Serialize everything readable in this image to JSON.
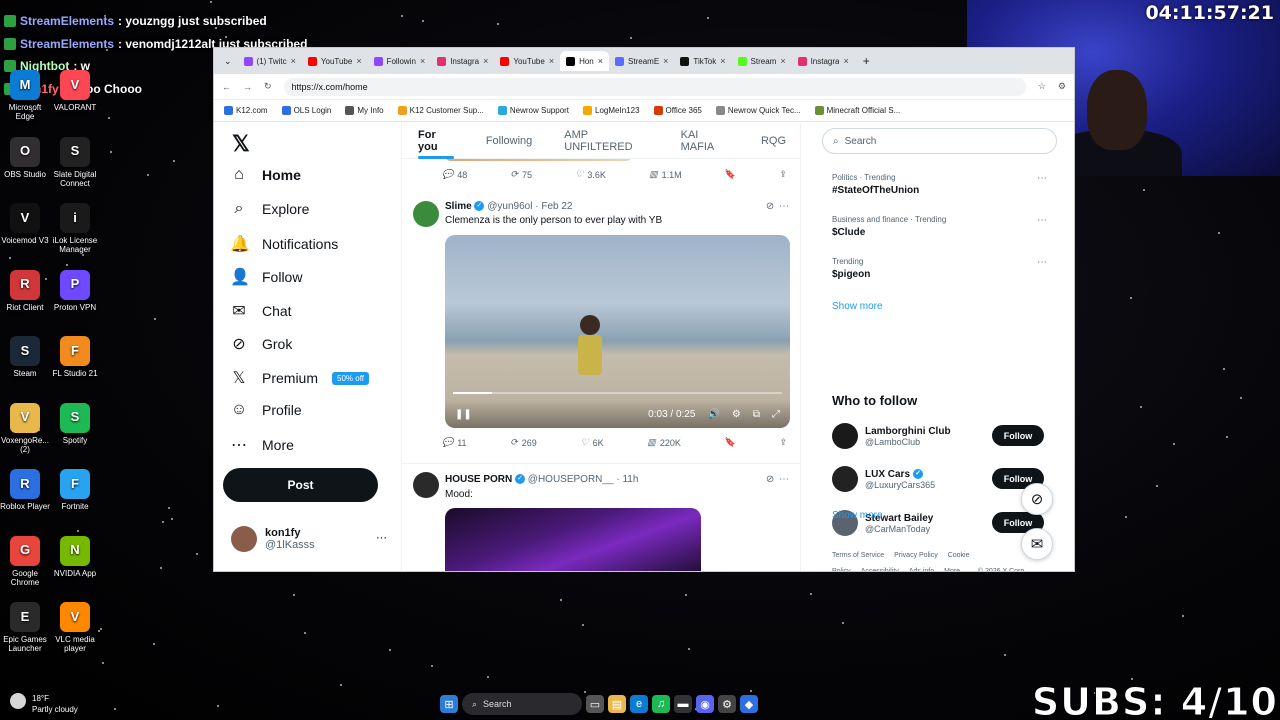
{
  "overlay": {
    "alerts": [
      {
        "who": "StreamElements",
        "text": ": youzngg just subscribed"
      },
      {
        "who": "StreamElements",
        "text": ": venomdj1212alt just subscribed"
      },
      {
        "who": "Nightbot",
        "text": ": w"
      },
      {
        "who": "kon1fy",
        "text": ": Choo Chooo"
      }
    ],
    "clock": "04:11:57:21",
    "subs": "SUBS: 4/10"
  },
  "desktop": {
    "icons": [
      {
        "label": "Microsoft Edge",
        "icon": "edge-icon",
        "color": "#0c7bd3"
      },
      {
        "label": "VALORANT",
        "icon": "valorant-icon",
        "color": "#ff4655"
      },
      {
        "label": "OBS Studio",
        "icon": "obs-icon",
        "color": "#302e31"
      },
      {
        "label": "Slate Digital Connect",
        "icon": "slate-icon",
        "color": "#222222"
      },
      {
        "label": "Voicemod V3",
        "icon": "voicemod-icon",
        "color": "#111111"
      },
      {
        "label": "iLok License Manager",
        "icon": "ilok-icon",
        "color": "#1a1a1a"
      },
      {
        "label": "Riot Client",
        "icon": "riot-icon",
        "color": "#d13639"
      },
      {
        "label": "Proton VPN",
        "icon": "proton-icon",
        "color": "#6d4aff"
      },
      {
        "label": "Steam",
        "icon": "steam-icon",
        "color": "#1b2838"
      },
      {
        "label": "FL Studio 21",
        "icon": "flstudio-icon",
        "color": "#f28b1e"
      },
      {
        "label": "VoxengoRe... (2)",
        "icon": "folder-icon",
        "color": "#e9b84a"
      },
      {
        "label": "Spotify",
        "icon": "spotify-icon",
        "color": "#1db954"
      },
      {
        "label": "Roblox Player",
        "icon": "roblox-icon",
        "color": "#2b6fe0"
      },
      {
        "label": "Fortnite",
        "icon": "fortnite-icon",
        "color": "#29a3f0"
      },
      {
        "label": "Google Chrome",
        "icon": "chrome-icon",
        "color": "#e8453c"
      },
      {
        "label": "NVIDIA App",
        "icon": "nvidia-icon",
        "color": "#76b900"
      },
      {
        "label": "Epic Games Launcher",
        "icon": "epic-icon",
        "color": "#2a2a2a"
      },
      {
        "label": "VLC media player",
        "icon": "vlc-icon",
        "color": "#ff8800"
      }
    ]
  },
  "browser": {
    "tabs": [
      {
        "label": "(1) Twitc",
        "color": "#9146ff"
      },
      {
        "label": "YouTube",
        "color": "#ff0000"
      },
      {
        "label": "Followin",
        "color": "#9146ff"
      },
      {
        "label": "Instagra",
        "color": "#e1306c"
      },
      {
        "label": "YouTube",
        "color": "#ff0000"
      },
      {
        "label": "Hon",
        "color": "#000000"
      },
      {
        "label": "StreamE",
        "color": "#5b6bff"
      },
      {
        "label": "TikTok",
        "color": "#111111"
      },
      {
        "label": "Stream",
        "color": "#53fc18"
      },
      {
        "label": "Instagra",
        "color": "#e1306c"
      }
    ],
    "url": "https://x.com/home",
    "bookmarks": [
      "K12.com",
      "OLS Login",
      "My Info",
      "K12 Customer Sup...",
      "Newrow Support",
      "LogMeIn123",
      "Office 365",
      "Newrow Quick Tec...",
      "Minecraft Official S..."
    ]
  },
  "nav": {
    "items": [
      {
        "label": "Home",
        "icon": "home-icon",
        "glyph": "⌂"
      },
      {
        "label": "Explore",
        "icon": "search-icon",
        "glyph": "⌕"
      },
      {
        "label": "Notifications",
        "icon": "bell-icon",
        "glyph": "🔔"
      },
      {
        "label": "Follow",
        "icon": "person-add-icon",
        "glyph": "👤"
      },
      {
        "label": "Chat",
        "icon": "mail-icon",
        "glyph": "✉"
      },
      {
        "label": "Grok",
        "icon": "grok-icon",
        "glyph": "⊘"
      },
      {
        "label": "Premium",
        "icon": "x-icon",
        "glyph": "𝕏"
      },
      {
        "label": "Profile",
        "icon": "profile-icon",
        "glyph": "☺"
      },
      {
        "label": "More",
        "icon": "more-icon",
        "glyph": "⋯"
      }
    ],
    "premium_badge": "50% off",
    "post_label": "Post",
    "user_name": "kon1fy",
    "user_handle": "@1lKasss"
  },
  "feed": {
    "tabs": [
      "For you",
      "Following",
      "AMP UNFILTERED",
      "KAI MAFIA",
      "RQG"
    ],
    "prev_actions": {
      "replies": "48",
      "reposts": "75",
      "likes": "3.6K",
      "views": "1.1M"
    },
    "tweet1": {
      "name": "Slime",
      "handle": "@yun96ol",
      "date": "Feb 22",
      "text": "Clemenza is the only person to ever play with YB",
      "video_time": "0:03 / 0:25",
      "progress": 0.12,
      "replies": "11",
      "reposts": "269",
      "likes": "6K",
      "views": "220K"
    },
    "tweet2": {
      "name": "HOUSE PORN",
      "handle": "@HOUSEPORN__",
      "date": "11h",
      "text": "Mood:"
    }
  },
  "sidebar": {
    "search_placeholder": "Search",
    "trends": [
      {
        "category": "Politics · Trending",
        "topic": "#StateOfTheUnion"
      },
      {
        "category": "Business and finance · Trending",
        "topic": "$Clude"
      },
      {
        "category": "Trending",
        "topic": "$pigeon"
      }
    ],
    "show_more": "Show more",
    "who_to_follow_title": "Who to follow",
    "who_to_follow": [
      {
        "name": "Lamborghini Club",
        "handle": "@LamboClub",
        "verified": false,
        "color": "#1a1a1a"
      },
      {
        "name": "LUX Cars",
        "handle": "@LuxuryCars365",
        "verified": true,
        "color": "#222222"
      },
      {
        "name": "Stewart Bailey",
        "handle": "@CarManToday",
        "verified": false,
        "color": "#5a6470"
      }
    ],
    "follow_label": "Follow",
    "footer": [
      "Terms of Service",
      "Privacy Policy",
      "Cookie Policy",
      "Accessibility",
      "Ads info",
      "More ...",
      "© 2026 X Corp."
    ]
  },
  "taskbar": {
    "temp": "18°F",
    "weather": "Partly cloudy",
    "search": "Search"
  }
}
